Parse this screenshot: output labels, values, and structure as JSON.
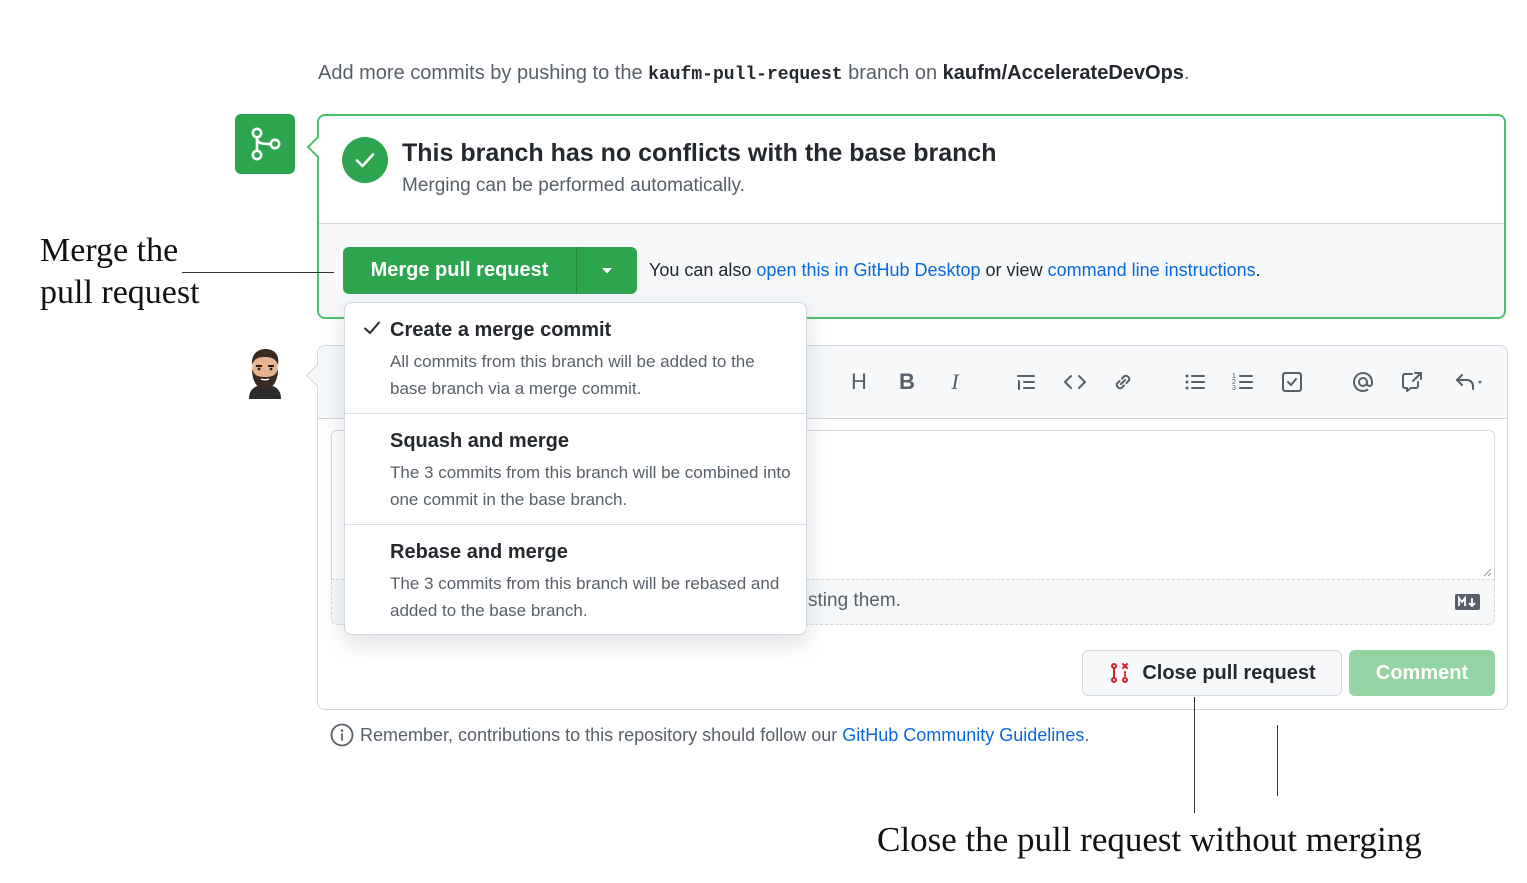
{
  "intro": {
    "prefix": "Add more commits by pushing to the ",
    "branch": "kaufm-pull-request",
    "middle": " branch on ",
    "repo": "kaufm/AccelerateDevOps",
    "suffix": "."
  },
  "merge_status": {
    "title": "This branch has no conflicts with the base branch",
    "subtitle": "Merging can be performed automatically."
  },
  "merge_button": {
    "label": "Merge pull request"
  },
  "alternatives": {
    "prefix": "You can also ",
    "desktop_link": "open this in GitHub Desktop",
    "middle": " or view ",
    "cli_link": "command line instructions",
    "suffix": "."
  },
  "merge_options": [
    {
      "title": "Create a merge commit",
      "description": "All commits from this branch will be added to the base branch via a merge commit.",
      "selected": true
    },
    {
      "title": "Squash and merge",
      "description": "The 3 commits from this branch will be combined into one commit in the base branch.",
      "selected": false
    },
    {
      "title": "Rebase and merge",
      "description": "The 3 commits from this branch will be rebased and added to the base branch.",
      "selected": false
    }
  ],
  "editor": {
    "toolbar": [
      "heading-icon",
      "bold-icon",
      "italic-icon",
      "quote-icon",
      "code-icon",
      "link-icon",
      "unordered-list-icon",
      "ordered-list-icon",
      "task-list-icon",
      "mention-icon",
      "reference-icon",
      "reply-icon"
    ],
    "attach_text": "sting them.",
    "markdown_badge": "MD"
  },
  "actions": {
    "close_label": "Close pull request",
    "comment_label": "Comment"
  },
  "guidelines": {
    "prefix": "Remember, contributions to this repository should follow our ",
    "link": "GitHub Community Guidelines",
    "suffix": "."
  },
  "annotations": {
    "merge_line1": "Merge the",
    "merge_line2": "pull request",
    "close": "Close the pull request without merging"
  },
  "colors": {
    "success": "#2da44e",
    "success_border": "#4ac26b",
    "link": "#0969da",
    "comment_disabled": "#94d3a2",
    "danger": "#cf222e"
  }
}
